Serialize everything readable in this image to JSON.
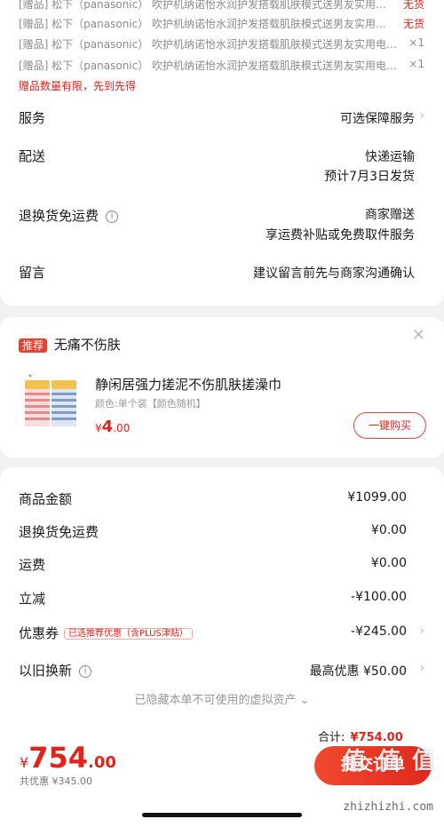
{
  "gifts": [
    {
      "text": "[赠品] 松下（panasonic） 吹护机纳诺怡水润护发搭载肌肤模式送男友实用…",
      "qty": "无货",
      "qty_color": "#e2231a"
    },
    {
      "text": "[赠品] 松下（panasonic） 吹护机纳诺怡水润护发搭载肌肤模式送男友实用…",
      "qty": "无货",
      "qty_color": "#e2231a"
    },
    {
      "text": "[赠品] 松下（panasonic） 吹护机纳诺怡水润护发搭载肌肤模式送男友实用电…",
      "qty": "×1",
      "qty_color": "#8c8c8c"
    },
    {
      "text": "[赠品] 松下（panasonic） 吹护机纳诺怡水润护发搭载肌肤模式送男友实用电…",
      "qty": "×1",
      "qty_color": "#8c8c8c"
    }
  ],
  "gift_notice": "赠品数量有限，先到先得",
  "service": {
    "label": "服务",
    "value": "可选保障服务"
  },
  "delivery": {
    "label": "配送",
    "method": "快递运输",
    "eta": "预计7月3日发货"
  },
  "return_fee": {
    "label": "退换货免运费",
    "line1": "商家赠送",
    "line2": "享运费补贴或免费取件服务"
  },
  "message": {
    "label": "留言",
    "placeholder": "建议留言前先与商家沟通确认"
  },
  "recommend": {
    "tag": "推荐",
    "title": "无痛不伤肤",
    "product_name": "静闲居强力搓泥不伤肌肤搓澡巾",
    "spec": "颜色:单个装【颜色随机】",
    "price_symbol": "¥",
    "price_int": "4",
    "price_dec": ".00",
    "buy_label": "一键购买"
  },
  "summary": {
    "goods": {
      "label": "商品金额",
      "value": "¥1099.00"
    },
    "return_fee": {
      "label": "退换货免运费",
      "value": "¥0.00"
    },
    "shipping": {
      "label": "运费",
      "value": "¥0.00"
    },
    "discount": {
      "label": "立减",
      "value": "-¥100.00"
    },
    "coupon": {
      "label": "优惠券",
      "tag": "已选推荐优惠（含PLUS津贴）",
      "value": "-¥245.00"
    },
    "trade_in": {
      "label": "以旧换新",
      "value": "最高优惠 ¥50.00"
    },
    "hidden_note": "已隐藏本单不可使用的虚拟资产"
  },
  "bottom": {
    "total_label": "合计:",
    "total_value": "¥754.00",
    "price_symbol": "¥",
    "price_int": "754",
    "price_dec": ".00",
    "saved": "共优惠 ¥345.00",
    "submit_label": "提交订单"
  },
  "watermark": {
    "text": "值 值 值",
    "url": "zhizhizhi.com"
  },
  "colors": {
    "accent": "#e2231a",
    "page_bg": "#f2f2f2"
  }
}
